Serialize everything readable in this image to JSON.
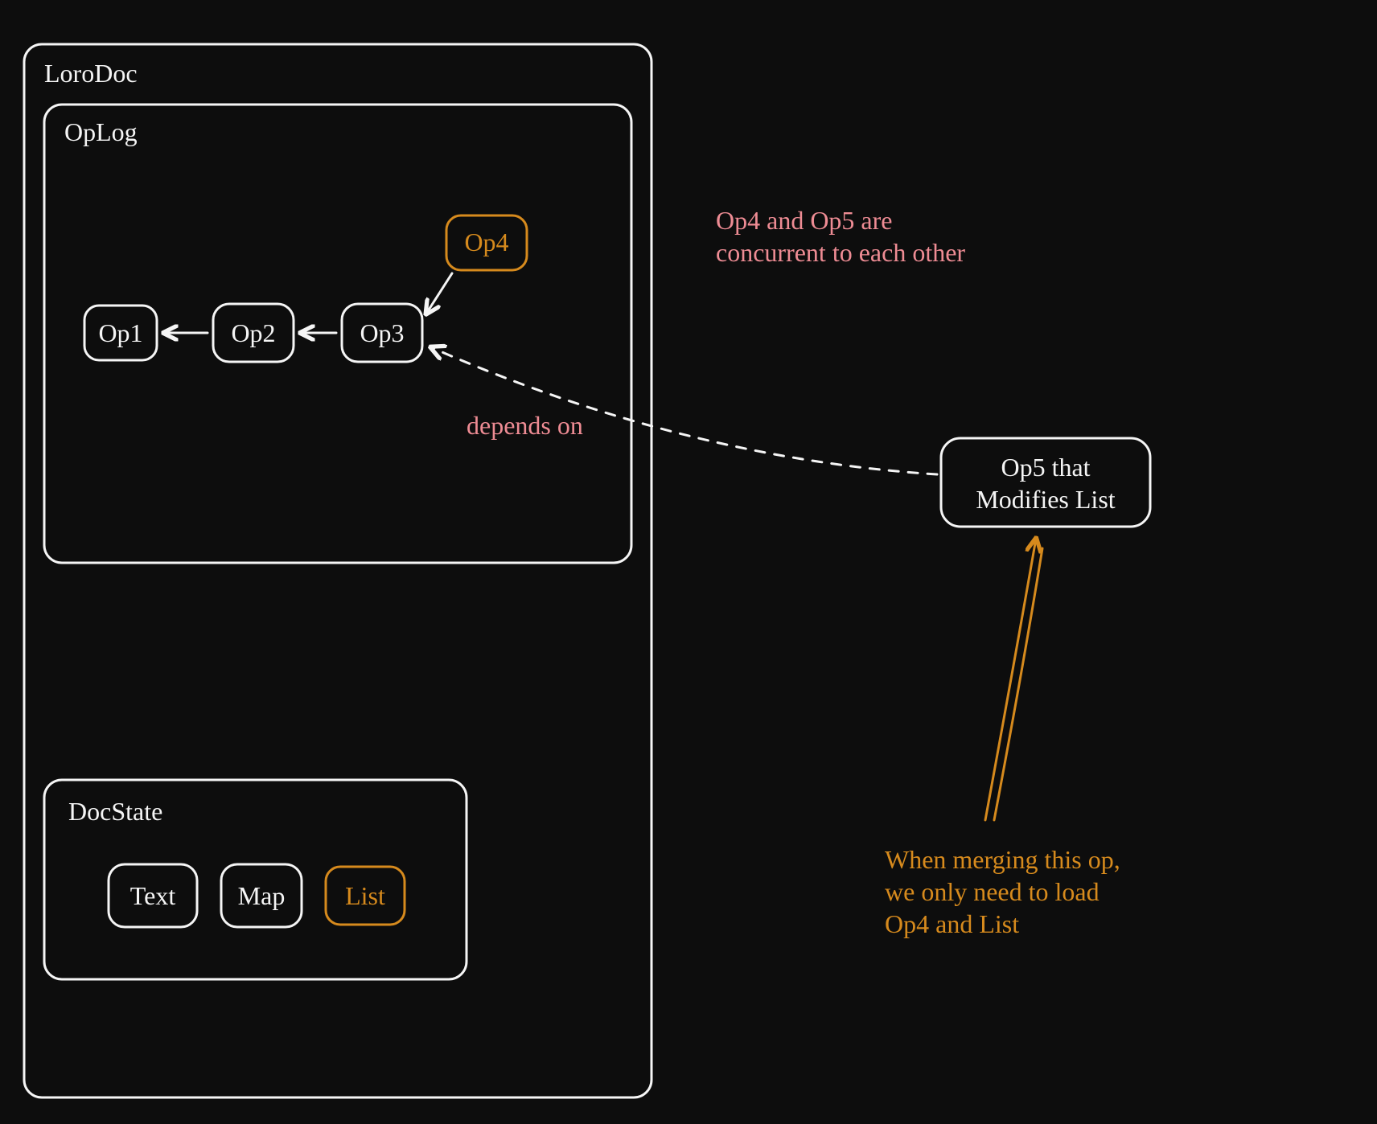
{
  "container": {
    "title": "LoroDoc"
  },
  "oplog": {
    "title": "OpLog",
    "ops": [
      "Op1",
      "Op2",
      "Op3",
      "Op4"
    ],
    "depends_label": "depends on"
  },
  "docstate": {
    "title": "DocState",
    "items": [
      "Text",
      "Map",
      "List"
    ]
  },
  "external_op": {
    "line1": "Op5 that",
    "line2": "Modifies List"
  },
  "annotation_top": {
    "line1": "Op4 and Op5 are",
    "line2": "concurrent to each other"
  },
  "annotation_bottom": {
    "line1": "When merging this op,",
    "line2": "we only need to load",
    "line3": "Op4 and List"
  }
}
